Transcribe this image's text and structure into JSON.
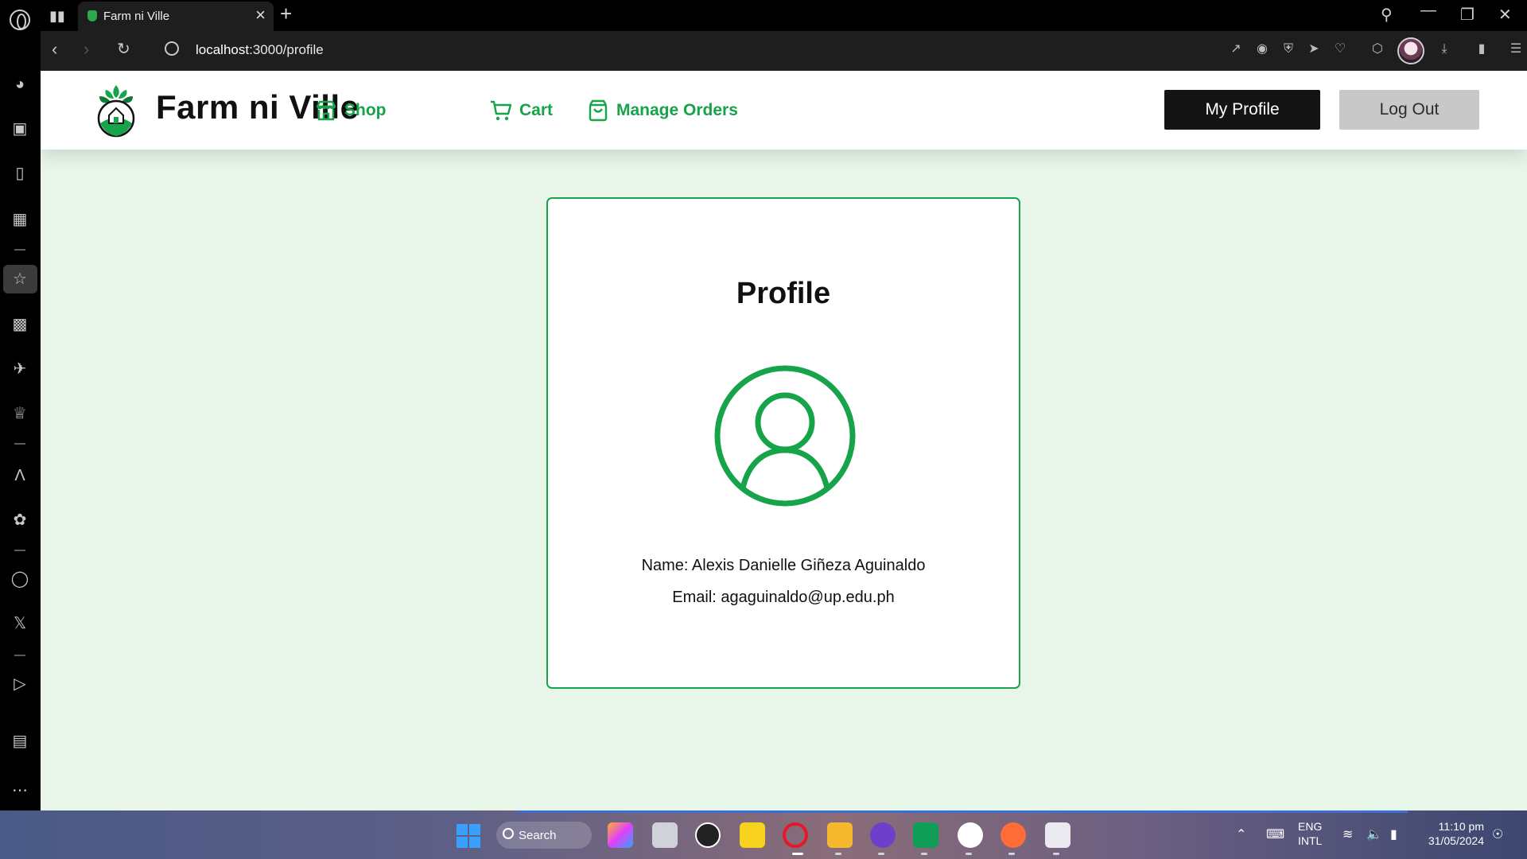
{
  "browser": {
    "tab_title": "Farm ni Ville",
    "url_host": "localhost",
    "url_path": ":3000/profile"
  },
  "site": {
    "brand": "Farm ni Ville",
    "nav": {
      "shop": "Shop",
      "cart": "Cart",
      "manage_orders": "Manage Orders"
    },
    "buttons": {
      "my_profile": "My Profile",
      "log_out": "Log Out"
    },
    "accent_color": "#16a34a"
  },
  "profile": {
    "title": "Profile",
    "name_line": "Name: Alexis Danielle Giñeza Aguinaldo",
    "email_line": "Email: agaguinaldo@up.edu.ph"
  },
  "taskbar": {
    "search_label": "Search",
    "language": "ENG",
    "language_sub": "INTL",
    "time": "11:10 pm",
    "date": "31/05/2024"
  }
}
